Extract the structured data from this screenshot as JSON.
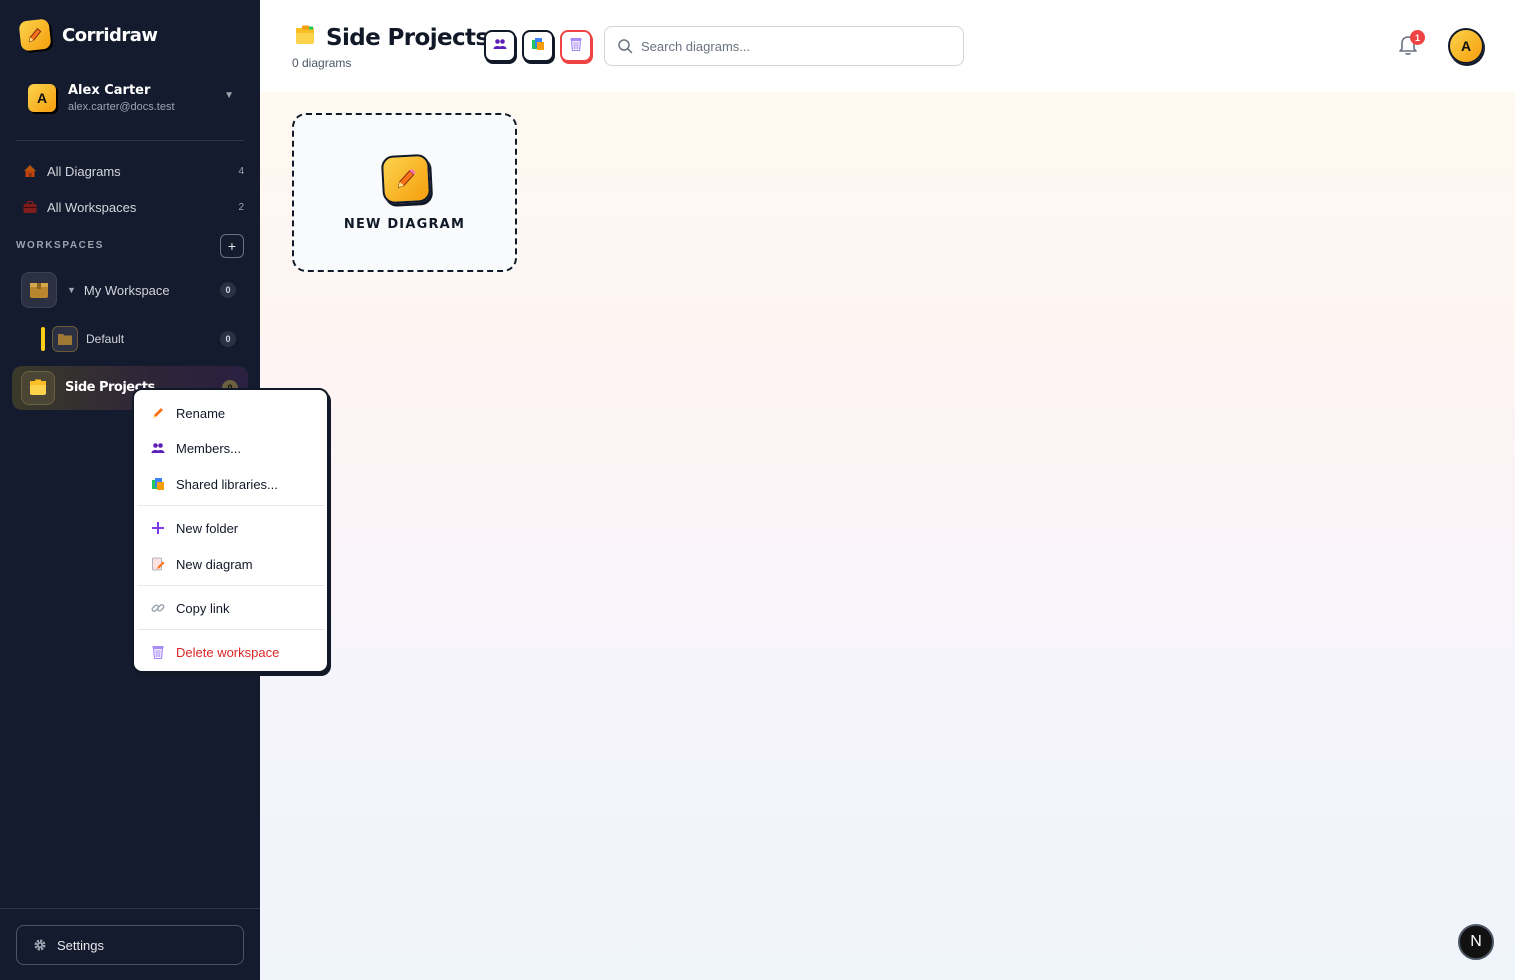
{
  "app": {
    "name": "Corridraw"
  },
  "user": {
    "initial": "A",
    "name": "Alex Carter",
    "email": "alex.carter@docs.test"
  },
  "nav": {
    "all_diagrams": {
      "label": "All Diagrams",
      "count": "4"
    },
    "all_workspaces": {
      "label": "All Workspaces",
      "count": "2"
    }
  },
  "workspaces": {
    "header": "WORKSPACES",
    "add_label": "+",
    "items": [
      {
        "label": "My Workspace",
        "count": "0"
      },
      {
        "label": "Default",
        "count": "0"
      },
      {
        "label": "Side Projects",
        "count": "0"
      }
    ]
  },
  "settings": {
    "label": "Settings"
  },
  "header": {
    "title": "Side Projects",
    "subtitle": "0 diagrams",
    "search_placeholder": "Search diagrams...",
    "notification_count": "1",
    "avatar_initial": "A"
  },
  "new_card": {
    "label": "NEW DIAGRAM"
  },
  "fab": {
    "label": "N"
  },
  "context_menu": {
    "rename": "Rename",
    "members": "Members...",
    "shared_libraries": "Shared libraries...",
    "new_folder": "New folder",
    "new_diagram": "New diagram",
    "copy_link": "Copy link",
    "delete_workspace": "Delete workspace"
  },
  "colors": {
    "sidebar_bg": "#151b2e",
    "accent": "#f59e0b",
    "danger": "#dc2626",
    "notification": "#ef4444"
  }
}
